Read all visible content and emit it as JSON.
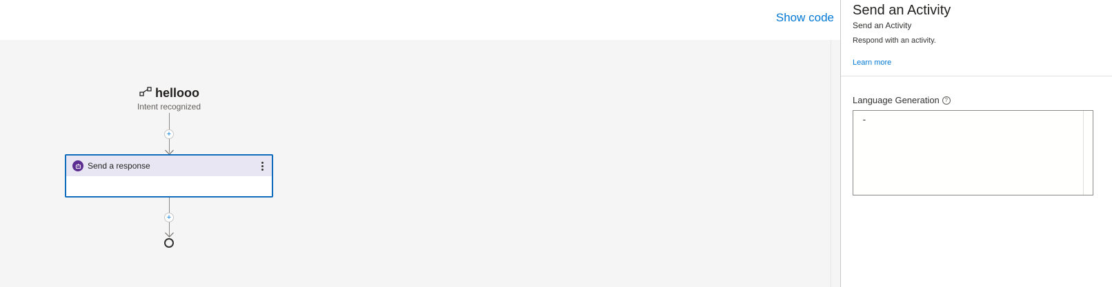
{
  "toolbar": {
    "show_code_label": "Show code"
  },
  "flow": {
    "trigger": {
      "title": "hellooo",
      "subtitle": "Intent recognized",
      "icon": "intent-icon"
    },
    "action": {
      "title": "Send a response",
      "icon": "bot-icon"
    },
    "end": {
      "icon": "end-circle-icon"
    }
  },
  "panel": {
    "title": "Send an Activity",
    "subtitle": "Send an Activity",
    "description": "Respond with an activity.",
    "learn_more": "Learn more",
    "lg_label": "Language Generation",
    "lg_value": "-"
  },
  "colors": {
    "accent": "#0078d4",
    "selected_border": "#0f6cbd",
    "action_header": "#e8e6f2",
    "bot_icon": "#5c2e91",
    "canvas_bg": "#f5f5f5"
  }
}
